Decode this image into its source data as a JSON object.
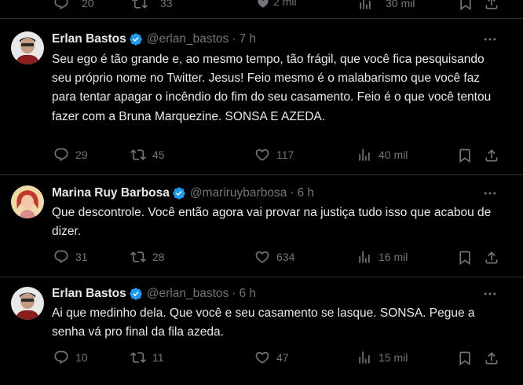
{
  "top": {
    "replies": "20",
    "retweets": "33",
    "likes": "",
    "views": "2 mil",
    "views2": "30 mil"
  },
  "tweets": [
    {
      "name": "Erlan Bastos",
      "handle": "@erlan_bastos",
      "time": "7 h",
      "text": "Seu ego é tão grande e, ao mesmo tempo, tão frágil, que você fica pesquisando seu próprio nome no Twitter. Jesus! Feio mesmo é o malabarismo que você faz para tentar apagar o incêndio do fim do seu casamento. Feio é o que você tentou fazer com a Bruna Marquezine. SONSA E AZEDA.",
      "replies": "29",
      "retweets": "45",
      "likes": "117",
      "views": "40 mil"
    },
    {
      "name": "Marina Ruy Barbosa",
      "handle": "@mariruybarbosa",
      "time": "6 h",
      "text": "Que descontrole. Você então agora vai provar na justiça tudo isso que acabou de dizer.",
      "replies": "31",
      "retweets": "28",
      "likes": "634",
      "views": "16 mil"
    },
    {
      "name": "Erlan Bastos",
      "handle": "@erlan_bastos",
      "time": "6 h",
      "text": "Ai que medinho dela. Que você e seu casamento se lasque. SONSA. Pegue a senha vá pro final da fila azeda.",
      "replies": "10",
      "retweets": "11",
      "likes": "47",
      "views": "15 mil"
    }
  ],
  "colors": {
    "background": "#000000",
    "text": "#e7e9ea",
    "muted": "#71767b",
    "verified": "#1d9bf0",
    "divider": "#2f3336"
  },
  "icons": [
    "verified-badge-icon",
    "more-icon",
    "reply-icon",
    "retweet-icon",
    "like-icon",
    "views-icon",
    "bookmark-icon",
    "share-icon"
  ]
}
